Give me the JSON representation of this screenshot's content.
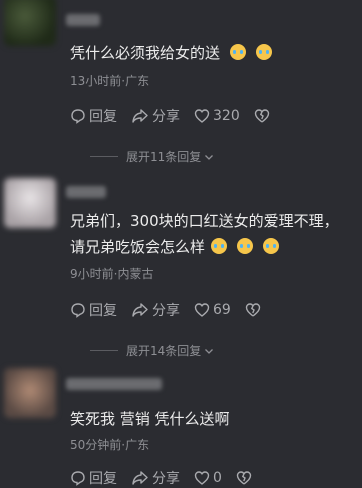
{
  "comments": [
    {
      "text": "凭什么必须我给女的送",
      "meta": "13小时前·广东",
      "reply_label": "回复",
      "share_label": "分享",
      "likes": "320",
      "expand_label": "展开11条回复"
    },
    {
      "text": "兄弟们，300块的口红送女的爱理不理，请兄弟吃饭会怎么样",
      "meta": "9小时前·内蒙古",
      "reply_label": "回复",
      "share_label": "分享",
      "likes": "69",
      "expand_label": "展开14条回复"
    },
    {
      "text": "笑死我 营销 凭什么送啊",
      "meta": "50分钟前·广东",
      "reply_label": "回复",
      "share_label": "分享",
      "likes": "0"
    }
  ],
  "icons": {
    "reply": "reply-bubble-icon",
    "share": "share-arrow-icon",
    "like": "heart-icon",
    "dislike": "broken-heart-icon",
    "emoji": "crying-face-emoji",
    "expand": "chevron-down-icon"
  }
}
